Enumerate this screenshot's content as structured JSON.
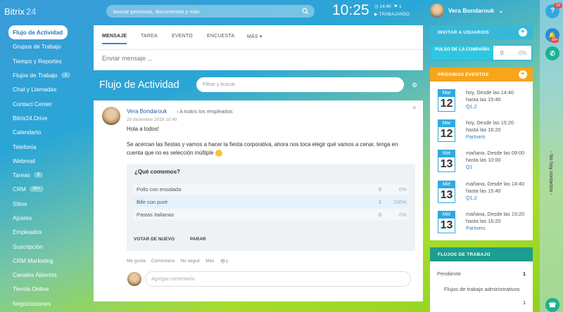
{
  "brand": {
    "name": "Bitrix",
    "suffix": "24"
  },
  "header": {
    "search_placeholder": "buscar personas, documentos y más",
    "clock": "10:25",
    "time_small": "14:40",
    "flag_count": "1",
    "status": "TRABAJANDO",
    "user": "Vera Bondarouk"
  },
  "sidebar": {
    "items": [
      {
        "label": "Flujo de Actividad",
        "badge": ""
      },
      {
        "label": "Grupos de Trabajo",
        "badge": ""
      },
      {
        "label": "Tiempo y Reportes",
        "badge": ""
      },
      {
        "label": "Flujos de Trabajo",
        "badge": "1"
      },
      {
        "label": "Chat y Llamadas",
        "badge": ""
      },
      {
        "label": "Contact Center",
        "badge": ""
      },
      {
        "label": "Bitrix24.Drive",
        "badge": ""
      },
      {
        "label": "Calendario",
        "badge": ""
      },
      {
        "label": "Telefonía",
        "badge": ""
      },
      {
        "label": "Webmail",
        "badge": ""
      },
      {
        "label": "Tareas",
        "badge": "8"
      },
      {
        "label": "CRM",
        "badge": "50+"
      },
      {
        "label": "Sitios",
        "badge": ""
      },
      {
        "label": "Ajustes",
        "badge": ""
      },
      {
        "label": "Empleados",
        "badge": ""
      },
      {
        "label": "Suscripción",
        "badge": ""
      },
      {
        "label": "CRM Marketing",
        "badge": ""
      },
      {
        "label": "Canales Abiertos",
        "badge": ""
      },
      {
        "label": "Tienda Online",
        "badge": ""
      },
      {
        "label": "Negociaciones",
        "badge": ""
      }
    ]
  },
  "composer": {
    "tabs": [
      "MENSAJE",
      "TAREA",
      "EVENTO",
      "ENCUESTA",
      "MÁS"
    ],
    "placeholder": "Enviar mensaje ..."
  },
  "feed": {
    "title": "Flujo de Actividad",
    "filter_placeholder": "Filtrar y buscar"
  },
  "post": {
    "author": "Vera Bondarouk",
    "audience": "A todos los empleados",
    "date": "20 diciembre 2018 10:40",
    "greeting": "Hola a todos!",
    "body": "Se acercan las fiestas y vamos a hacer la fiesta corporativa, ahora nos toca elegir qué vamos a cenar, tenga en cuenta que no es selección múltiple",
    "poll": {
      "question": "¿Qué comemos?",
      "options": [
        {
          "label": "Pollo con ensalada",
          "count": "0",
          "pct": "0%"
        },
        {
          "label": "Bife con puré",
          "count": "1",
          "pct": "100%"
        },
        {
          "label": "Pastas Italianas",
          "count": "0",
          "pct": "0%"
        }
      ],
      "vote_again": "VOTAR DE NUEVO",
      "stop": "PARAR"
    },
    "actions": {
      "like": "Me gusta",
      "comment": "Comentario",
      "unfollow": "No seguir",
      "more": "Más",
      "views": "1"
    },
    "comment_placeholder": "Agregar comentario"
  },
  "right": {
    "invite": "INVITAR A USUARIOS",
    "pulse_label": "PULSO DE LA COMPAÑÍA",
    "pulse_value": "0",
    "pulse_pct": "0%",
    "events_title": "PRÓXIMOS EVENTOS",
    "events": [
      {
        "month": "Mar",
        "day": "12",
        "line1": "hoy, Desde las 14:40",
        "line2": "hasta las 15:40",
        "place": "Q1,2"
      },
      {
        "month": "Mar",
        "day": "12",
        "line1": "hoy, Desde las 15:20",
        "line2": "hasta las 16:20",
        "place": "Partners"
      },
      {
        "month": "Mié",
        "day": "13",
        "line1": "mañana, Desde las 09:00",
        "line2": "hasta las 10:00",
        "place": "Q1"
      },
      {
        "month": "Mié",
        "day": "13",
        "line1": "mañana, Desde las 14:40",
        "line2": "hasta las 15:40",
        "place": "Q1,2"
      },
      {
        "month": "Mié",
        "day": "13",
        "line1": "mañana, Desde las 15:20",
        "line2": "hasta las 16:20",
        "place": "Partners"
      }
    ],
    "flows_title": "FLUJOS DE TRABAJO",
    "pending": "Pendiente",
    "pending_count": "1",
    "flows_sub": "Flujos de trabajo administrativos",
    "flows_sub_count": "1"
  },
  "farright": {
    "help_badge": "15",
    "bell_badge": "99+",
    "no_contacts": "- No hay contactos -"
  }
}
